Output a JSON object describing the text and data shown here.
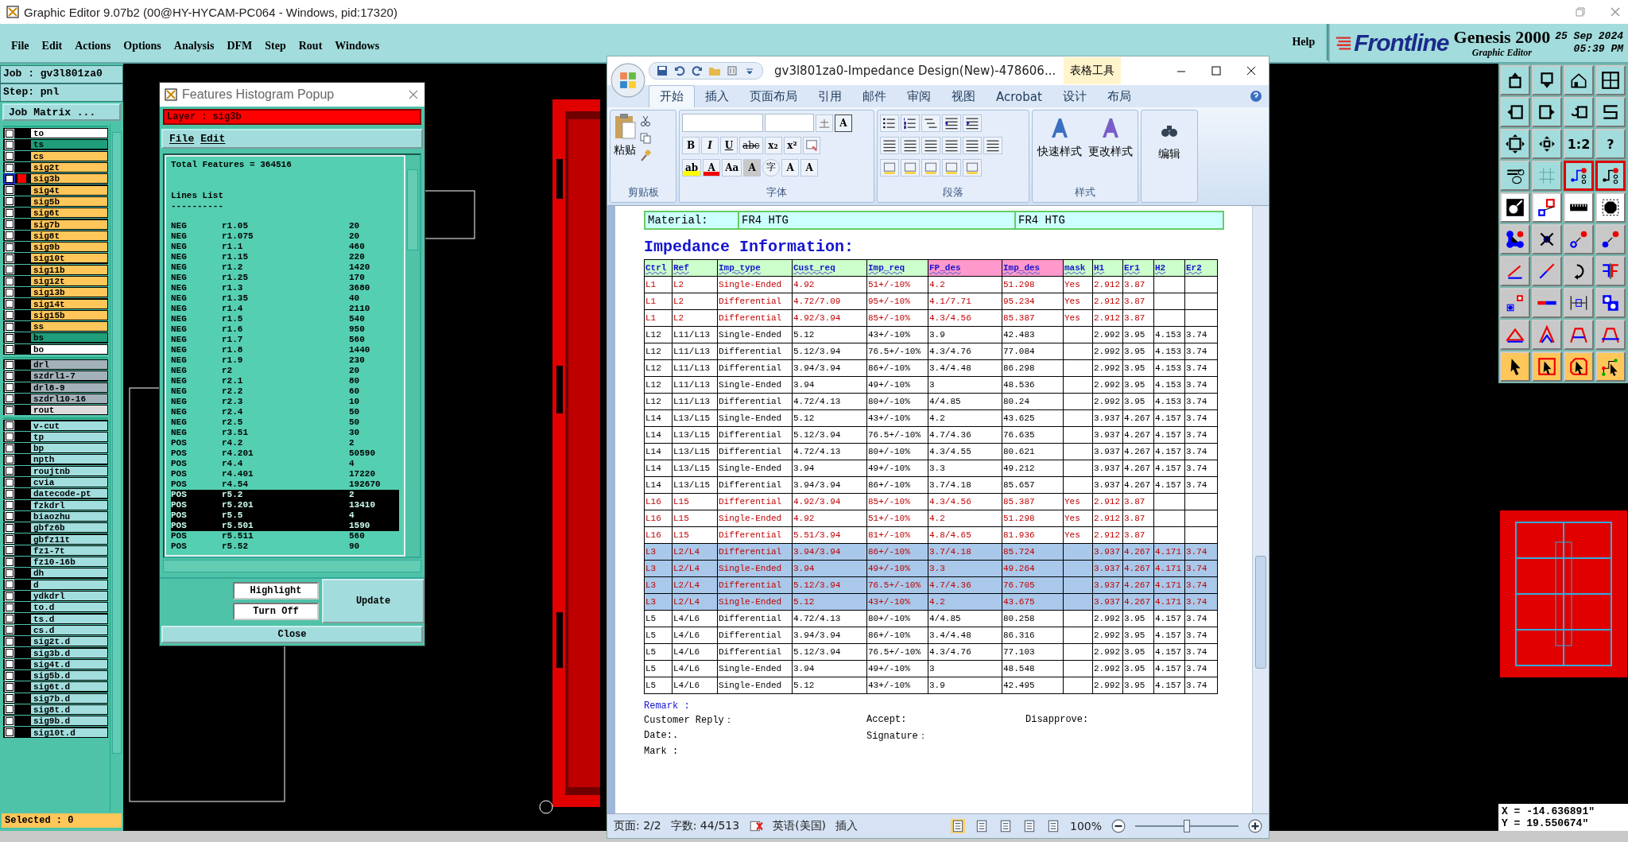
{
  "window": {
    "title": "Graphic Editor 9.07b2 (00@HY-HYCAM-PC064 - Windows, pid:17320)"
  },
  "menu": [
    "File",
    "Edit",
    "Actions",
    "Options",
    "Analysis",
    "DFM",
    "Step",
    "Rout",
    "Windows"
  ],
  "help": "Help",
  "brand": {
    "logo": "Frontline",
    "product": "Genesis 2000",
    "subtitle": "Graphic Editor",
    "date": "25 Sep 2024",
    "time": "05:39 PM"
  },
  "job": "Job : gv3l801za0",
  "step": "Step: pnl",
  "job_matrix": "Job Matrix ...",
  "layer_groups": [
    [
      {
        "checked": false,
        "name": "to",
        "color": "#ffffff",
        "selected": false
      },
      {
        "checked": false,
        "name": "ts",
        "color": "#1e9e7a",
        "selected": false
      },
      {
        "checked": false,
        "name": "cs",
        "color": "#ffc65a",
        "selected": false
      },
      {
        "checked": false,
        "name": "sig2t",
        "color": "#ffc65a",
        "selected": false
      },
      {
        "checked": false,
        "name": "sig3b",
        "color": "#ffc65a",
        "selected": true
      },
      {
        "checked": false,
        "name": "sig4t",
        "color": "#ffc65a",
        "selected": false
      },
      {
        "checked": false,
        "name": "sig5b",
        "color": "#ffc65a",
        "selected": false
      },
      {
        "checked": false,
        "name": "sig6t",
        "color": "#ffc65a",
        "selected": false
      },
      {
        "checked": false,
        "name": "sig7b",
        "color": "#ffc65a",
        "selected": false
      },
      {
        "checked": false,
        "name": "sig8t",
        "color": "#ffc65a",
        "selected": false
      },
      {
        "checked": false,
        "name": "sig9b",
        "color": "#ffc65a",
        "selected": false
      },
      {
        "checked": false,
        "name": "sig10t",
        "color": "#ffc65a",
        "selected": false
      },
      {
        "checked": false,
        "name": "sig11b",
        "color": "#ffc65a",
        "selected": false
      },
      {
        "checked": false,
        "name": "sig12t",
        "color": "#ffc65a",
        "selected": false
      },
      {
        "checked": false,
        "name": "sig13b",
        "color": "#ffc65a",
        "selected": false
      },
      {
        "checked": false,
        "name": "sig14t",
        "color": "#ffc65a",
        "selected": false
      },
      {
        "checked": false,
        "name": "sig15b",
        "color": "#ffc65a",
        "selected": false
      },
      {
        "checked": false,
        "name": "ss",
        "color": "#ffc65a",
        "selected": false
      },
      {
        "checked": false,
        "name": "bs",
        "color": "#1e9e7a",
        "selected": false
      },
      {
        "checked": false,
        "name": "bo",
        "color": "#ffffff",
        "selected": false
      }
    ],
    [
      {
        "checked": false,
        "name": "drl",
        "color": "#a3b2ba",
        "selected": false
      },
      {
        "checked": false,
        "name": "szdrl1-7",
        "color": "#a3b2ba",
        "selected": false
      },
      {
        "checked": false,
        "name": "drl8-9",
        "color": "#a3b2ba",
        "selected": false
      },
      {
        "checked": false,
        "name": "szdrl10-16",
        "color": "#a3b2ba",
        "selected": false
      },
      {
        "checked": false,
        "name": "rout",
        "color": "#dcdcdc",
        "selected": false
      }
    ],
    [
      {
        "checked": false,
        "name": "v-cut",
        "color": "#a2dede",
        "selected": false
      },
      {
        "checked": false,
        "name": "tp",
        "color": "#a2dede",
        "selected": false
      },
      {
        "checked": false,
        "name": "bp",
        "color": "#a2dede",
        "selected": false
      },
      {
        "checked": false,
        "name": "npth",
        "color": "#a2dede",
        "selected": false
      },
      {
        "checked": false,
        "name": "roujtnb",
        "color": "#a2dede",
        "selected": false
      },
      {
        "checked": false,
        "name": "cvia",
        "color": "#a2dede",
        "selected": false
      },
      {
        "checked": false,
        "name": "datecode-pt",
        "color": "#a2dede",
        "selected": false
      },
      {
        "checked": false,
        "name": "fzkdrl",
        "color": "#a2dede",
        "selected": false
      },
      {
        "checked": false,
        "name": "biaozhu",
        "color": "#a2dede",
        "selected": false
      },
      {
        "checked": false,
        "name": "gbfz6b",
        "color": "#a2dede",
        "selected": false
      },
      {
        "checked": false,
        "name": "gbfz11t",
        "color": "#a2dede",
        "selected": false
      },
      {
        "checked": false,
        "name": "fz1-7t",
        "color": "#a2dede",
        "selected": false
      },
      {
        "checked": false,
        "name": "fz10-16b",
        "color": "#a2dede",
        "selected": false
      },
      {
        "checked": false,
        "name": "dh",
        "color": "#a2dede",
        "selected": false
      },
      {
        "checked": false,
        "name": "d",
        "color": "#a2dede",
        "selected": false
      },
      {
        "checked": false,
        "name": "ydkdrl",
        "color": "#a2dede",
        "selected": false
      },
      {
        "checked": false,
        "name": "to.d",
        "color": "#a2dede",
        "selected": false
      },
      {
        "checked": false,
        "name": "ts.d",
        "color": "#a2dede",
        "selected": false
      },
      {
        "checked": false,
        "name": "cs.d",
        "color": "#a2dede",
        "selected": false
      },
      {
        "checked": false,
        "name": "sig2t.d",
        "color": "#a2dede",
        "selected": false
      },
      {
        "checked": false,
        "name": "sig3b.d",
        "color": "#a2dede",
        "selected": false
      },
      {
        "checked": false,
        "name": "sig4t.d",
        "color": "#a2dede",
        "selected": false
      },
      {
        "checked": false,
        "name": "sig5b.d",
        "color": "#a2dede",
        "selected": false
      },
      {
        "checked": false,
        "name": "sig6t.d",
        "color": "#a2dede",
        "selected": false
      },
      {
        "checked": false,
        "name": "sig7b.d",
        "color": "#a2dede",
        "selected": false
      },
      {
        "checked": false,
        "name": "sig8t.d",
        "color": "#a2dede",
        "selected": false
      },
      {
        "checked": false,
        "name": "sig9b.d",
        "color": "#a2dede",
        "selected": false
      },
      {
        "checked": false,
        "name": "sig10t.d",
        "color": "#a2dede",
        "selected": false
      }
    ]
  ],
  "selected_count": "Selected : 0",
  "tool_labels": [
    "1:2",
    "?"
  ],
  "coords": {
    "x": "X = -14.636891\"",
    "y": "Y = 19.550674\""
  },
  "histogram": {
    "title": "Features Histogram Popup",
    "layer": "Layer :  sig3b",
    "menu": [
      "File",
      "Edit"
    ],
    "total": "Total Features = 364516",
    "heading": "Lines List",
    "rule": "----------",
    "rows": [
      {
        "polarity": "NEG",
        "symbol": "r1.05",
        "count": "20",
        "selected": false
      },
      {
        "polarity": "NEG",
        "symbol": "r1.075",
        "count": "20",
        "selected": false
      },
      {
        "polarity": "NEG",
        "symbol": "r1.1",
        "count": "460",
        "selected": false
      },
      {
        "polarity": "NEG",
        "symbol": "r1.15",
        "count": "220",
        "selected": false
      },
      {
        "polarity": "NEG",
        "symbol": "r1.2",
        "count": "1420",
        "selected": false
      },
      {
        "polarity": "NEG",
        "symbol": "r1.25",
        "count": "170",
        "selected": false
      },
      {
        "polarity": "NEG",
        "symbol": "r1.3",
        "count": "3680",
        "selected": false
      },
      {
        "polarity": "NEG",
        "symbol": "r1.35",
        "count": "40",
        "selected": false
      },
      {
        "polarity": "NEG",
        "symbol": "r1.4",
        "count": "2110",
        "selected": false
      },
      {
        "polarity": "NEG",
        "symbol": "r1.5",
        "count": "540",
        "selected": false
      },
      {
        "polarity": "NEG",
        "symbol": "r1.6",
        "count": "950",
        "selected": false
      },
      {
        "polarity": "NEG",
        "symbol": "r1.7",
        "count": "560",
        "selected": false
      },
      {
        "polarity": "NEG",
        "symbol": "r1.8",
        "count": "1440",
        "selected": false
      },
      {
        "polarity": "NEG",
        "symbol": "r1.9",
        "count": "230",
        "selected": false
      },
      {
        "polarity": "NEG",
        "symbol": "r2",
        "count": "20",
        "selected": false
      },
      {
        "polarity": "NEG",
        "symbol": "r2.1",
        "count": "80",
        "selected": false
      },
      {
        "polarity": "NEG",
        "symbol": "r2.2",
        "count": "60",
        "selected": false
      },
      {
        "polarity": "NEG",
        "symbol": "r2.3",
        "count": "10",
        "selected": false
      },
      {
        "polarity": "NEG",
        "symbol": "r2.4",
        "count": "50",
        "selected": false
      },
      {
        "polarity": "NEG",
        "symbol": "r2.5",
        "count": "50",
        "selected": false
      },
      {
        "polarity": "NEG",
        "symbol": "r3.51",
        "count": "30",
        "selected": false
      },
      {
        "polarity": "POS",
        "symbol": "r4.2",
        "count": "2",
        "selected": false
      },
      {
        "polarity": "POS",
        "symbol": "r4.201",
        "count": "50590",
        "selected": false
      },
      {
        "polarity": "POS",
        "symbol": "r4.4",
        "count": "4",
        "selected": false
      },
      {
        "polarity": "POS",
        "symbol": "r4.401",
        "count": "17220",
        "selected": false
      },
      {
        "polarity": "POS",
        "symbol": "r4.54",
        "count": "192670",
        "selected": false
      },
      {
        "polarity": "POS",
        "symbol": "r5.2",
        "count": "2",
        "selected": true
      },
      {
        "polarity": "POS",
        "symbol": "r5.201",
        "count": "13410",
        "selected": true
      },
      {
        "polarity": "POS",
        "symbol": "r5.5",
        "count": "4",
        "selected": true
      },
      {
        "polarity": "POS",
        "symbol": "r5.501",
        "count": "1590",
        "selected": true
      },
      {
        "polarity": "POS",
        "symbol": "r5.511",
        "count": "560",
        "selected": false
      },
      {
        "polarity": "POS",
        "symbol": "r5.52",
        "count": "90",
        "selected": false
      }
    ],
    "buttons": {
      "highlight": "Highlight",
      "turn_off": "Turn Off",
      "update": "Update",
      "close": "Close"
    }
  },
  "word": {
    "title": "gv3l801za0-Impedance Design(New)-478606...",
    "context_tab": "表格工具",
    "tabs": [
      {
        "label": "开始",
        "selected": true
      },
      {
        "label": "插入",
        "selected": false
      },
      {
        "label": "页面布局",
        "selected": false
      },
      {
        "label": "引用",
        "selected": false
      },
      {
        "label": "邮件",
        "selected": false
      },
      {
        "label": "审阅",
        "selected": false
      },
      {
        "label": "视图",
        "selected": false
      },
      {
        "label": "Acrobat",
        "selected": false
      },
      {
        "label": "设计",
        "selected": false
      },
      {
        "label": "布局",
        "selected": false
      }
    ],
    "paste": "粘贴",
    "char_border": "A",
    "font_row2": [
      "B",
      "I",
      "U",
      "abc",
      "x₂",
      "x²"
    ],
    "font_row3": [
      {
        "label": "ab",
        "kind": "highlight"
      },
      {
        "label": "A",
        "kind": "color"
      },
      {
        "label": "Aa",
        "kind": "plain"
      },
      {
        "label": "A",
        "kind": "shaded"
      },
      {
        "label": "字",
        "kind": "circled"
      },
      {
        "label": "A",
        "kind": "grow"
      },
      {
        "label": "A",
        "kind": "shrink"
      }
    ],
    "styles": [
      "快速样式",
      "更改样式"
    ],
    "edit": "编辑",
    "groups": [
      "剪贴板",
      "字体",
      "段落",
      "样式"
    ],
    "material": [
      "Material:",
      "FR4 HTG",
      "FR4 HTG"
    ],
    "heading": "Impedance Information:",
    "columns": [
      {
        "label": "Ctrl",
        "color": "#ccffcc"
      },
      {
        "label": "Ref",
        "color": "#ccffcc"
      },
      {
        "label": "Imp_type",
        "color": "#ccffcc"
      },
      {
        "label": "Cust_req",
        "color": "#ccffcc"
      },
      {
        "label": "Imp_req",
        "color": "#ccffcc"
      },
      {
        "label": "FP_des",
        "color": "#ff99cc"
      },
      {
        "label": "Imp_des",
        "color": "#ff99cc"
      },
      {
        "label": "mask",
        "color": "#ccffcc"
      },
      {
        "label": "H1",
        "color": "#ccffcc"
      },
      {
        "label": "Er1",
        "color": "#ccffcc"
      },
      {
        "label": "H2",
        "color": "#ccffcc"
      },
      {
        "label": "Er2",
        "color": "#ccffcc"
      }
    ],
    "rows": [
      {
        "kind": "masked",
        "selected": false,
        "cells": [
          "L1",
          "L2",
          "Single-Ended",
          "4.92",
          "51+/-10%",
          "4.2",
          "51.298",
          "Yes",
          "2.912",
          "3.87",
          null,
          null
        ]
      },
      {
        "kind": "masked",
        "selected": false,
        "cells": [
          "L1",
          "L2",
          "Differential",
          "4.72/7.09",
          "95+/-10%",
          "4.1/7.71",
          "95.234",
          "Yes",
          "2.912",
          "3.87",
          null,
          null
        ]
      },
      {
        "kind": "masked",
        "selected": false,
        "cells": [
          "L1",
          "L2",
          "Differential",
          "4.92/3.94",
          "85+/-10%",
          "4.3/4.56",
          "85.387",
          "Yes",
          "2.912",
          "3.87",
          null,
          null
        ]
      },
      {
        "kind": "plain",
        "selected": false,
        "cells": [
          "L12",
          "L11/L13",
          "Single-Ended",
          "5.12",
          "43+/-10%",
          "3.9",
          "42.483",
          null,
          "2.992",
          "3.95",
          "4.153",
          "3.74"
        ]
      },
      {
        "kind": "plain",
        "selected": false,
        "cells": [
          "L12",
          "L11/L13",
          "Differential",
          "5.12/3.94",
          "76.5+/-10%",
          "4.3/4.76",
          "77.084",
          null,
          "2.992",
          "3.95",
          "4.153",
          "3.74"
        ]
      },
      {
        "kind": "plain",
        "selected": false,
        "cells": [
          "L12",
          "L11/L13",
          "Differential",
          "3.94/3.94",
          "86+/-10%",
          "3.4/4.48",
          "86.298",
          null,
          "2.992",
          "3.95",
          "4.153",
          "3.74"
        ]
      },
      {
        "kind": "plain",
        "selected": false,
        "cells": [
          "L12",
          "L11/L13",
          "Single-Ended",
          "3.94",
          "49+/-10%",
          "3",
          "48.536",
          null,
          "2.992",
          "3.95",
          "4.153",
          "3.74"
        ]
      },
      {
        "kind": "plain",
        "selected": false,
        "cells": [
          "L12",
          "L11/L13",
          "Differential",
          "4.72/4.13",
          "80+/-10%",
          "4/4.85",
          "80.24",
          null,
          "2.992",
          "3.95",
          "4.153",
          "3.74"
        ]
      },
      {
        "kind": "plain",
        "selected": false,
        "cells": [
          "L14",
          "L13/L15",
          "Single-Ended",
          "5.12",
          "43+/-10%",
          "4.2",
          "43.625",
          null,
          "3.937",
          "4.267",
          "4.157",
          "3.74"
        ]
      },
      {
        "kind": "plain",
        "selected": false,
        "cells": [
          "L14",
          "L13/L15",
          "Differential",
          "5.12/3.94",
          "76.5+/-10%",
          "4.7/4.36",
          "76.635",
          null,
          "3.937",
          "4.267",
          "4.157",
          "3.74"
        ]
      },
      {
        "kind": "plain",
        "selected": false,
        "cells": [
          "L14",
          "L13/L15",
          "Differential",
          "4.72/4.13",
          "80+/-10%",
          "4.3/4.55",
          "80.621",
          null,
          "3.937",
          "4.267",
          "4.157",
          "3.74"
        ]
      },
      {
        "kind": "plain",
        "selected": false,
        "cells": [
          "L14",
          "L13/L15",
          "Single-Ended",
          "3.94",
          "49+/-10%",
          "3.3",
          "49.212",
          null,
          "3.937",
          "4.267",
          "4.157",
          "3.74"
        ]
      },
      {
        "kind": "plain",
        "selected": false,
        "cells": [
          "L14",
          "L13/L15",
          "Differential",
          "3.94/3.94",
          "86+/-10%",
          "3.7/4.18",
          "85.657",
          null,
          "3.937",
          "4.267",
          "4.157",
          "3.74"
        ]
      },
      {
        "kind": "masked",
        "selected": false,
        "cells": [
          "L16",
          "L15",
          "Differential",
          "4.92/3.94",
          "85+/-10%",
          "4.3/4.56",
          "85.387",
          "Yes",
          "2.912",
          "3.87",
          null,
          null
        ]
      },
      {
        "kind": "masked",
        "selected": false,
        "cells": [
          "L16",
          "L15",
          "Single-Ended",
          "4.92",
          "51+/-10%",
          "4.2",
          "51.298",
          "Yes",
          "2.912",
          "3.87",
          null,
          null
        ]
      },
      {
        "kind": "masked",
        "selected": false,
        "cells": [
          "L16",
          "L15",
          "Differential",
          "5.51/3.94",
          "81+/-10%",
          "4.8/4.65",
          "81.936",
          "Yes",
          "2.912",
          "3.87",
          null,
          null
        ]
      },
      {
        "kind": "masked",
        "selected": true,
        "cells": [
          "L3",
          "L2/L4",
          "Differential",
          "3.94/3.94",
          "86+/-10%",
          "3.7/4.18",
          "85.724",
          null,
          "3.937",
          "4.267",
          "4.171",
          "3.74"
        ]
      },
      {
        "kind": "masked",
        "selected": true,
        "cells": [
          "L3",
          "L2/L4",
          "Single-Ended",
          "3.94",
          "49+/-10%",
          "3.3",
          "49.264",
          null,
          "3.937",
          "4.267",
          "4.171",
          "3.74"
        ]
      },
      {
        "kind": "masked",
        "selected": true,
        "cells": [
          "L3",
          "L2/L4",
          "Differential",
          "5.12/3.94",
          "76.5+/-10%",
          "4.7/4.36",
          "76.705",
          null,
          "3.937",
          "4.267",
          "4.171",
          "3.74"
        ]
      },
      {
        "kind": "masked",
        "selected": true,
        "cells": [
          "L3",
          "L2/L4",
          "Single-Ended",
          "5.12",
          "43+/-10%",
          "4.2",
          "43.675",
          null,
          "3.937",
          "4.267",
          "4.171",
          "3.74"
        ]
      },
      {
        "kind": "plain",
        "selected": false,
        "cells": [
          "L5",
          "L4/L6",
          "Differential",
          "4.72/4.13",
          "80+/-10%",
          "4/4.85",
          "80.258",
          null,
          "2.992",
          "3.95",
          "4.157",
          "3.74"
        ]
      },
      {
        "kind": "plain",
        "selected": false,
        "cells": [
          "L5",
          "L4/L6",
          "Differential",
          "3.94/3.94",
          "86+/-10%",
          "3.4/4.48",
          "86.316",
          null,
          "2.992",
          "3.95",
          "4.157",
          "3.74"
        ]
      },
      {
        "kind": "plain",
        "selected": false,
        "cells": [
          "L5",
          "L4/L6",
          "Differential",
          "5.12/3.94",
          "76.5+/-10%",
          "4.3/4.76",
          "77.103",
          null,
          "2.992",
          "3.95",
          "4.157",
          "3.74"
        ]
      },
      {
        "kind": "plain",
        "selected": false,
        "cells": [
          "L5",
          "L4/L6",
          "Single-Ended",
          "3.94",
          "49+/-10%",
          "3",
          "48.548",
          null,
          "2.992",
          "3.95",
          "4.157",
          "3.74"
        ]
      },
      {
        "kind": "plain",
        "selected": false,
        "cells": [
          "L5",
          "L4/L6",
          "Single-Ended",
          "5.12",
          "43+/-10%",
          "3.9",
          "42.495",
          null,
          "2.992",
          "3.95",
          "4.157",
          "3.74"
        ]
      }
    ],
    "remark": "Remark :",
    "remark_lines": [
      [
        "Customer Reply：",
        "Accept:",
        "Disapprove:"
      ],
      [
        "Date:.",
        "Signature："
      ],
      [
        "Mark :"
      ]
    ],
    "status": {
      "page": "页面: 2/2",
      "words": "字数: 44/513",
      "language": "英语(美国)",
      "mode": "插入",
      "zoom": "100%"
    },
    "zoom_slider": {
      "level": 0.5
    }
  }
}
